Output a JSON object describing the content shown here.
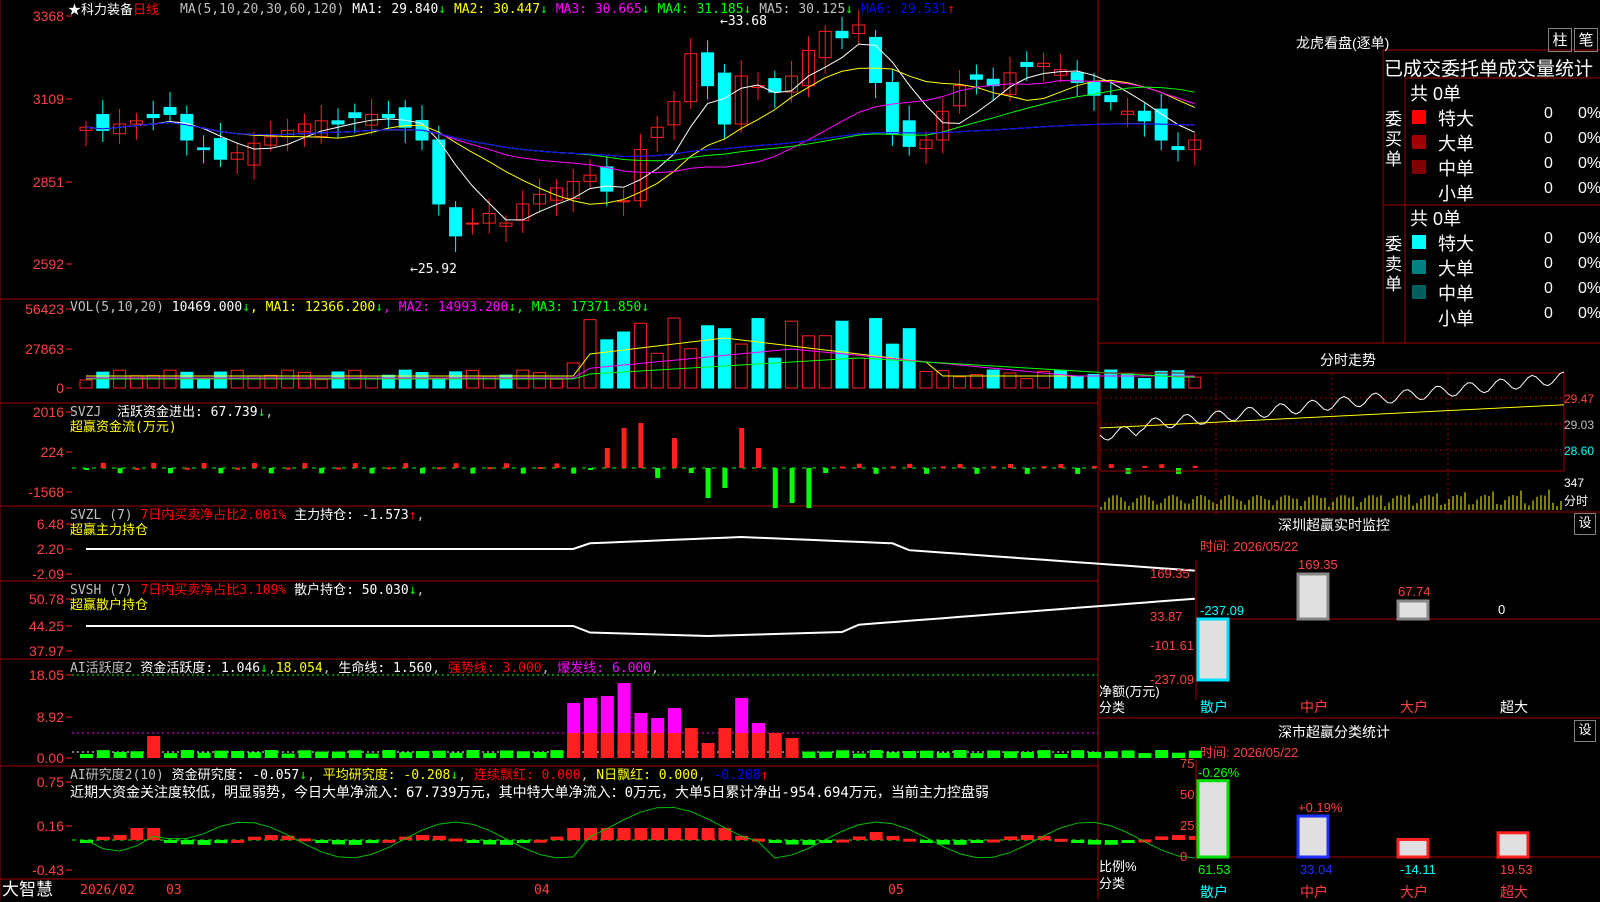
{
  "stock": {
    "name": "科力装备",
    "period": "日线",
    "star": "★"
  },
  "main": {
    "ma_label": "MA(5,10,20,30,60,120)",
    "ma_values": [
      {
        "name": "MA1",
        "value": "29.840",
        "arrow": "↓",
        "color": "#ffffff"
      },
      {
        "name": "MA2",
        "value": "30.447",
        "arrow": "↓",
        "color": "#ffff00"
      },
      {
        "name": "MA3",
        "value": "30.665",
        "arrow": "↓",
        "color": "#ff00ff"
      },
      {
        "name": "MA4",
        "value": "31.185",
        "arrow": "↓",
        "color": "#00ff00"
      },
      {
        "name": "MA5",
        "value": "30.125",
        "arrow": "↓",
        "color": "#c0c0c0"
      },
      {
        "name": "MA6",
        "value": "29.531",
        "arrow": "↑",
        "color": "#0000ff"
      }
    ],
    "yticks": [
      "3368",
      "3109",
      "2851",
      "2592"
    ],
    "high_mark": "←33.68",
    "low_mark": "←25.92"
  },
  "vol": {
    "label": "VOL(5,10,20)",
    "value": "10469.000",
    "ma": [
      {
        "name": "MA1",
        "value": "12366.200",
        "color": "#ffff00"
      },
      {
        "name": "MA2",
        "value": "14993.200",
        "color": "#ff00ff"
      },
      {
        "name": "MA3",
        "value": "17371.850",
        "color": "#00ff00"
      }
    ],
    "yticks": [
      "56423",
      "27863",
      "0"
    ]
  },
  "svzj": {
    "label": "SVZJ",
    "text": "活跃资金进出: 67.739",
    "arrow": "↓",
    "sub": "超赢资金流(万元)",
    "yticks": [
      "2016",
      "224",
      "-1568"
    ]
  },
  "svzl": {
    "label": "SVZL (7)",
    "text1": "7日内买卖净占比2.001%",
    "text2": "主力持仓: -1.573",
    "arrow": "↑",
    "sub": "超赢主力持仓",
    "yticks": [
      "6.48",
      "2.20",
      "-2.09"
    ]
  },
  "svsh": {
    "label": "SVSH (7)",
    "text1": "7日内买卖净占比3.109%",
    "text2": "散户持仓: 50.030",
    "arrow": "↓",
    "sub": "超赢散户持仓",
    "yticks": [
      "50.78",
      "44.25",
      "37.97"
    ]
  },
  "ai1": {
    "label": "AI活跃度2",
    "t1": "资金活跃度: 1.046",
    "t2": "18.054",
    "t3": "生命线: 1.560",
    "t4": "强势线: 3.000",
    "t5": "爆发线: 6.000",
    "yticks": [
      "18.05",
      "8.92",
      "0.00"
    ]
  },
  "ai2": {
    "label": "AI研究度2(10)",
    "t1": "资金研究度: -0.057",
    "t2": "平均研究度: -0.208",
    "t3": "连续飘红: 0.000",
    "t4": "N日飘红: 0.000",
    "t5": "-0.208",
    "comment": "近期大资金关注度较低，明显弱势，今日大单净流入：67.739万元，其中特大单净流入：0万元，大单5日累计净出-954.694万元，当前主力控盘弱",
    "yticks": [
      "0.75",
      "0.16",
      "-0.43"
    ]
  },
  "bottom": {
    "logo": "大智慧",
    "dates": [
      "2026/02",
      "03",
      "04",
      "05"
    ]
  },
  "dragon": {
    "title": "龙虎看盘(逐单)",
    "btn1": "柱",
    "btn2": "笔",
    "header": "已成交委托单成交量统计",
    "buy": {
      "side": "委买单",
      "total": "共 0单",
      "rows": [
        {
          "name": "特大",
          "val": "0",
          "pct": "0%",
          "color": "#ff0000"
        },
        {
          "name": "大单",
          "val": "0",
          "pct": "0%",
          "color": "#a00000"
        },
        {
          "name": "中单",
          "val": "0",
          "pct": "0%",
          "color": "#800000"
        },
        {
          "name": "小单",
          "val": "0",
          "pct": "0%",
          "color": ""
        }
      ]
    },
    "sell": {
      "side": "委卖单",
      "total": "共 0单",
      "rows": [
        {
          "name": "特大",
          "val": "0",
          "pct": "0%",
          "color": "#00ffff"
        },
        {
          "name": "大单",
          "val": "0",
          "pct": "0%",
          "color": "#008080"
        },
        {
          "name": "中单",
          "val": "0",
          "pct": "0%",
          "color": "#006060"
        },
        {
          "name": "小单",
          "val": "0",
          "pct": "0%",
          "color": ""
        }
      ]
    }
  },
  "intraday": {
    "title": "分时走势",
    "p1": "29.47",
    "p2": "29.03",
    "p3": "28.60",
    "vol": "347",
    "unit": "分时"
  },
  "monitor": {
    "title": "深圳超赢实时监控",
    "btn": "设",
    "time": "时间: 2026/05/22",
    "yticks": [
      "169.35",
      "33.87",
      "-101.61",
      "-237.09"
    ],
    "ylabel": "净额(万元)",
    "xlabel": "分类",
    "cats": [
      "散户",
      "中户",
      "大户",
      "超大"
    ],
    "values": [
      -237.09,
      169.35,
      67.74,
      0
    ],
    "labels": [
      "-237.09",
      "169.35",
      "67.74",
      "0"
    ]
  },
  "classify": {
    "title": "深市超赢分类统计",
    "btn": "设",
    "time": "时间: 2026/05/22",
    "yticks": [
      "75",
      "50",
      "25",
      "0"
    ],
    "ylabel": "比例%",
    "xlabel": "分类",
    "cats": [
      "散户",
      "中户",
      "大户",
      "超大"
    ],
    "values": [
      61.53,
      33.04,
      14.11,
      19.53
    ],
    "labels": [
      "61.53",
      "33.04",
      "-14.11",
      "19.53"
    ],
    "changes": [
      "-0.26%",
      "+0.19%",
      "",
      ""
    ]
  },
  "chart_data": {
    "type": "candlestick",
    "title": "科力装备 日线",
    "x": [
      "2026/02",
      "03",
      "04",
      "05"
    ],
    "ylim": [
      25.92,
      33.68
    ],
    "ohlc_close": [
      30.2,
      30.1,
      30.3,
      30.4,
      30.5,
      30.6,
      29.8,
      29.5,
      29.2,
      29.4,
      29.7,
      29.9,
      30.1,
      30.3,
      30.4,
      30.3,
      30.5,
      30.6,
      30.5,
      30.2,
      29.8,
      27.8,
      26.8,
      27.2,
      27.5,
      27.2,
      27.8,
      28.1,
      28.3,
      28.5,
      28.7,
      28.2,
      27.9,
      29.5,
      30.2,
      31.0,
      32.5,
      31.5,
      30.3,
      31.8,
      31.5,
      31.3,
      31.8,
      32.6,
      33.2,
      33.0,
      33.4,
      31.6,
      30.0,
      29.6,
      29.8,
      30.7,
      31.5,
      31.7,
      31.5,
      31.9,
      32.1,
      32.2,
      32.0,
      31.6,
      31.2,
      31.0,
      30.7,
      30.4,
      29.8,
      29.5,
      29.8
    ]
  }
}
